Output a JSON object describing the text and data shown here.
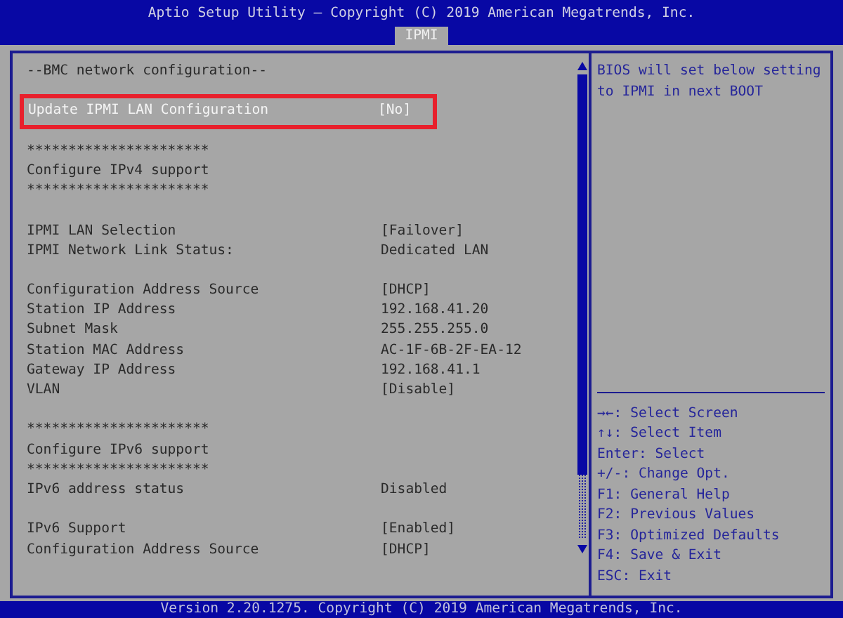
{
  "header": {
    "title": "Aptio Setup Utility – Copyright (C) 2019 American Megatrends, Inc.",
    "tabs": [
      {
        "label": "IPMI",
        "selected": true
      }
    ]
  },
  "groups": [
    {
      "settings": [
        {
          "kind": "text",
          "label": "--BMC network configuration--"
        }
      ]
    },
    {
      "settings": [
        {
          "kind": "option",
          "label": "Update IPMI LAN Configuration",
          "value": "[No]",
          "selected": true
        }
      ]
    },
    {
      "settings": [
        {
          "kind": "text",
          "label": "**********************"
        },
        {
          "kind": "text",
          "label": "Configure IPv4 support"
        },
        {
          "kind": "text",
          "label": "**********************"
        }
      ]
    },
    {
      "settings": [
        {
          "kind": "option",
          "label": "IPMI LAN Selection",
          "value": "[Failover]",
          "selected": false
        },
        {
          "kind": "info",
          "label": "IPMI Network Link Status:",
          "value": "Dedicated LAN"
        }
      ]
    },
    {
      "settings": [
        {
          "kind": "option",
          "label": "Configuration Address Source",
          "value": "[DHCP]",
          "selected": false
        },
        {
          "kind": "info",
          "label": "Station IP Address",
          "value": "192.168.41.20"
        },
        {
          "kind": "info",
          "label": "Subnet Mask",
          "value": "255.255.255.0"
        },
        {
          "kind": "info",
          "label": "Station MAC Address",
          "value": "AC-1F-6B-2F-EA-12"
        },
        {
          "kind": "info",
          "label": "Gateway IP Address",
          "value": "192.168.41.1"
        },
        {
          "kind": "option",
          "label": "VLAN",
          "value": "[Disable]",
          "selected": false
        }
      ]
    },
    {
      "settings": [
        {
          "kind": "text",
          "label": "**********************"
        },
        {
          "kind": "text",
          "label": "Configure IPv6 support"
        },
        {
          "kind": "text",
          "label": "**********************"
        },
        {
          "kind": "info",
          "label": "IPv6 address status",
          "value": "Disabled"
        }
      ]
    },
    {
      "settings": [
        {
          "kind": "option",
          "label": "IPv6 Support",
          "value": "[Enabled]",
          "selected": false
        },
        {
          "kind": "option",
          "label": "Configuration Address Source",
          "value": "[DHCP]",
          "selected": false
        }
      ]
    }
  ],
  "help": [
    "BIOS will set below setting",
    "to IPMI in next BOOT"
  ],
  "keys": [
    "→←: Select Screen",
    "↑↓: Select Item",
    "Enter: Select",
    "+/-: Change Opt.",
    "F1: General Help",
    "F2: Previous Values",
    "F3: Optimized Defaults",
    "F4: Save & Exit",
    "ESC: Exit"
  ],
  "footer": "Version 2.20.1275. Copyright (C) 2019 American Megatrends, Inc."
}
